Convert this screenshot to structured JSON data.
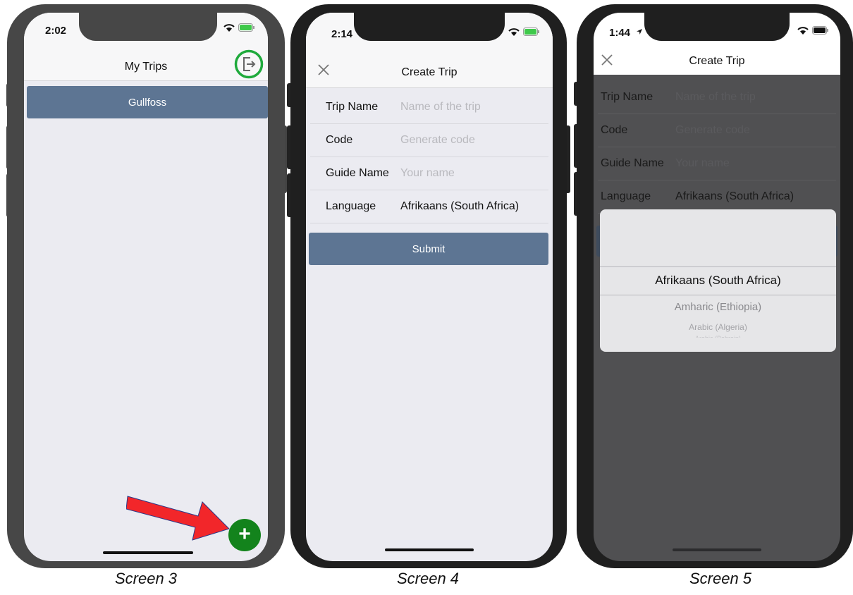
{
  "screen3": {
    "time": "2:02",
    "title": "My Trips",
    "trips": [
      {
        "name": "Gullfoss"
      }
    ],
    "add_symbol": "+",
    "icons": [
      "logout-icon",
      "add-icon",
      "annotation-arrow",
      "wifi-icon",
      "battery-icon"
    ]
  },
  "screen4": {
    "time": "2:14",
    "title": "Create Trip",
    "fields": {
      "trip_name": {
        "label": "Trip Name",
        "placeholder": "Name of the trip"
      },
      "code": {
        "label": "Code",
        "placeholder": "Generate code"
      },
      "guide_name": {
        "label": "Guide Name",
        "placeholder": "Your name"
      },
      "language": {
        "label": "Language",
        "value": "Afrikaans (South Africa)"
      }
    },
    "submit_label": "Submit"
  },
  "screen5": {
    "time": "1:44",
    "title": "Create Trip",
    "fields": {
      "trip_name": {
        "label": "Trip Name",
        "placeholder": "Name of the trip"
      },
      "code": {
        "label": "Code",
        "placeholder": "Generate code"
      },
      "guide_name": {
        "label": "Guide Name",
        "placeholder": "Your name"
      },
      "language": {
        "label": "Language",
        "value": "Afrikaans (South Africa)"
      }
    },
    "picker": {
      "selected": "Afrikaans (South Africa)",
      "options": [
        "Amharic (Ethiopia)",
        "Arabic (Algeria)",
        "Arabic (Bahrain)"
      ]
    }
  },
  "captions": [
    "Screen 3",
    "Screen 4",
    "Screen 5"
  ],
  "colors": {
    "accent_button": "#5d7593",
    "fab_green": "#13831c",
    "highlight_circle": "#1faa3c",
    "arrow_red": "#f2262a",
    "screen_bg": "#ebebf1",
    "overlay_dark": "#505052"
  }
}
